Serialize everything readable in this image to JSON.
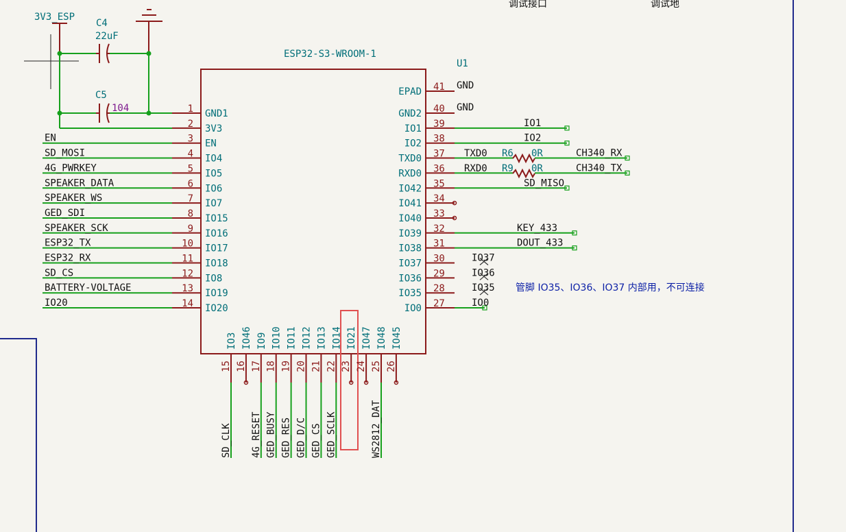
{
  "colors": {
    "wire": "#16a01c",
    "pin": "#8b1a1a",
    "body": "#8b1a1a",
    "pin_name": "#006e78",
    "net_label": "#111111",
    "note": "#0b1fa6",
    "value": "#7d1a8e",
    "highlight": "#e05050",
    "frame": "#1f2a8c",
    "background": "#f5f4ef"
  },
  "header": {
    "left_text": "调试接口",
    "right_text": "调试地"
  },
  "power": {
    "supply": "3V3_ESP",
    "c4_ref": "C4",
    "c4_value": "22uF",
    "c5_ref": "C5",
    "c5_value": "104"
  },
  "component": {
    "value": "ESP32-S3-WROOM-1",
    "ref": "U1"
  },
  "left_pins": [
    {
      "num": "1",
      "name": "GND1",
      "net": ""
    },
    {
      "num": "2",
      "name": "3V3",
      "net": ""
    },
    {
      "num": "3",
      "name": "EN",
      "net": "EN"
    },
    {
      "num": "4",
      "name": "IO4",
      "net": "SD_MOSI"
    },
    {
      "num": "5",
      "name": "IO5",
      "net": "4G_PWRKEY"
    },
    {
      "num": "6",
      "name": "IO6",
      "net": "SPEAKER_DATA"
    },
    {
      "num": "7",
      "name": "IO7",
      "net": "SPEAKER_WS"
    },
    {
      "num": "8",
      "name": "IO15",
      "net": "GED_SDI"
    },
    {
      "num": "9",
      "name": "IO16",
      "net": "SPEAKER_SCK"
    },
    {
      "num": "10",
      "name": "IO17",
      "net": "ESP32_TX"
    },
    {
      "num": "11",
      "name": "IO18",
      "net": "ESP32_RX"
    },
    {
      "num": "12",
      "name": "IO8",
      "net": "SD_CS"
    },
    {
      "num": "13",
      "name": "IO19",
      "net": "BATTERY-VOLTAGE"
    },
    {
      "num": "14",
      "name": "IO20",
      "net": "IO20"
    }
  ],
  "right_pins": [
    {
      "num": "41",
      "name": "EPAD",
      "net": "GND"
    },
    {
      "num": "40",
      "name": "GND2",
      "net": "GND"
    },
    {
      "num": "39",
      "name": "IO1",
      "net": "IO1"
    },
    {
      "num": "38",
      "name": "IO2",
      "net": "IO2"
    },
    {
      "num": "37",
      "name": "TXD0",
      "net": "CH340_RX",
      "local": "TXD0",
      "res_ref": "R6",
      "res_value": "0R"
    },
    {
      "num": "36",
      "name": "RXD0",
      "net": "CH340_TX",
      "local": "RXD0",
      "res_ref": "R9",
      "res_value": "0R"
    },
    {
      "num": "35",
      "name": "IO42",
      "net": "SD_MISO"
    },
    {
      "num": "34",
      "name": "IO41",
      "net": ""
    },
    {
      "num": "33",
      "name": "IO40",
      "net": ""
    },
    {
      "num": "32",
      "name": "IO39",
      "net": "KEY_433"
    },
    {
      "num": "31",
      "name": "IO38",
      "net": "DOUT_433"
    },
    {
      "num": "30",
      "name": "IO37",
      "net": "IO37"
    },
    {
      "num": "29",
      "name": "IO36",
      "net": "IO36"
    },
    {
      "num": "28",
      "name": "IO35",
      "net": "IO35"
    },
    {
      "num": "27",
      "name": "IO0",
      "net": "IO0"
    }
  ],
  "bottom_pins": [
    {
      "num": "15",
      "name": "IO3",
      "net": "SD_CLK"
    },
    {
      "num": "16",
      "name": "IO46",
      "net": ""
    },
    {
      "num": "17",
      "name": "IO9",
      "net": "4G_RESET"
    },
    {
      "num": "18",
      "name": "IO10",
      "net": "GED_BUSY"
    },
    {
      "num": "19",
      "name": "IO11",
      "net": "GED_RES"
    },
    {
      "num": "20",
      "name": "IO12",
      "net": "GED_D/C"
    },
    {
      "num": "21",
      "name": "IO13",
      "net": "GED_CS"
    },
    {
      "num": "22",
      "name": "IO14",
      "net": "GED_SCLK"
    },
    {
      "num": "23",
      "name": "IO21",
      "net": ""
    },
    {
      "num": "24",
      "name": "IO47",
      "net": ""
    },
    {
      "num": "25",
      "name": "IO48",
      "net": "WS2812_DAT"
    },
    {
      "num": "26",
      "name": "IO45",
      "net": ""
    }
  ],
  "note": "管脚 IO35、IO36、IO37 内部用，不可连接"
}
